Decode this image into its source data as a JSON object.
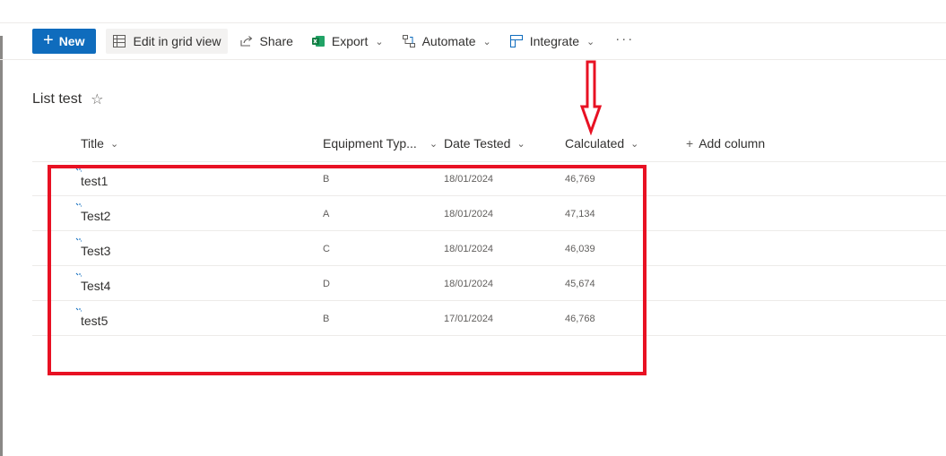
{
  "toolbar": {
    "new_label": "New",
    "edit_grid_label": "Edit in grid view",
    "share_label": "Share",
    "export_label": "Export",
    "automate_label": "Automate",
    "integrate_label": "Integrate",
    "more_label": "···"
  },
  "list": {
    "title": "List test",
    "columns": {
      "title": "Title",
      "equipment": "Equipment Typ...",
      "date": "Date Tested",
      "calculated": "Calculated",
      "add": "Add column"
    },
    "rows": [
      {
        "title": "test1",
        "equipment": "B",
        "date": "18/01/2024",
        "calculated": "46,769"
      },
      {
        "title": "Test2",
        "equipment": "A",
        "date": "18/01/2024",
        "calculated": "47,134"
      },
      {
        "title": "Test3",
        "equipment": "C",
        "date": "18/01/2024",
        "calculated": "46,039"
      },
      {
        "title": "Test4",
        "equipment": "D",
        "date": "18/01/2024",
        "calculated": "45,674"
      },
      {
        "title": "test5",
        "equipment": "B",
        "date": "17/01/2024",
        "calculated": "46,768"
      }
    ]
  },
  "colors": {
    "accent": "#0f6cbd",
    "annotation": "#e81123"
  },
  "icons": [
    "plus-icon",
    "grid-view-icon",
    "share-icon",
    "excel-icon",
    "automate-icon",
    "integrate-icon",
    "favorite-star-icon",
    "new-item-icon",
    "chevron-down-icon"
  ]
}
